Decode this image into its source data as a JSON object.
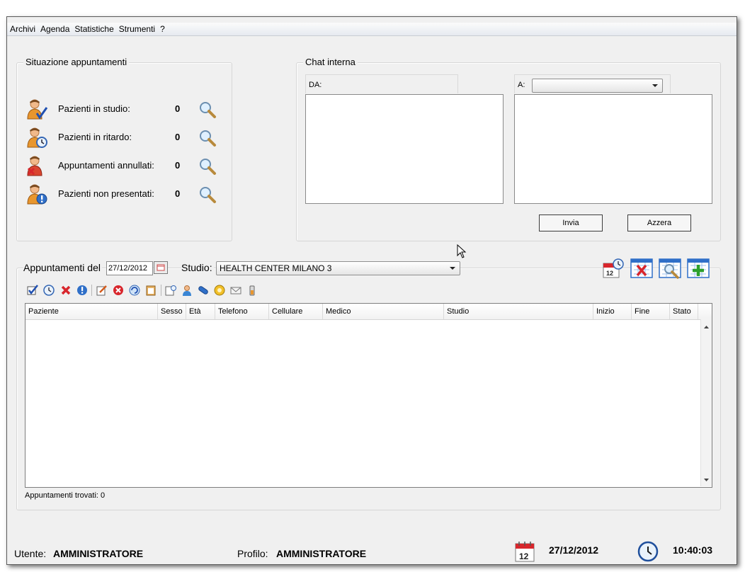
{
  "menu": {
    "items": [
      "Archivi",
      "Agenda",
      "Statistiche",
      "Strumenti",
      "?"
    ]
  },
  "situation": {
    "title": "Situazione appuntamenti",
    "rows": [
      {
        "label": "Pazienti in studio:",
        "value": "0",
        "icon": "patient-check-icon"
      },
      {
        "label": "Pazienti in ritardo:",
        "value": "0",
        "icon": "patient-clock-icon"
      },
      {
        "label": "Appuntamenti annullati:",
        "value": "0",
        "icon": "patient-cancel-icon"
      },
      {
        "label": "Pazienti non presentati:",
        "value": "0",
        "icon": "patient-alert-icon"
      }
    ]
  },
  "chat": {
    "title": "Chat interna",
    "from_label": "DA:",
    "to_label": "A:",
    "to_value": "",
    "send_label": "Invia",
    "reset_label": "Azzera"
  },
  "appointments": {
    "date_label": "Appuntamenti del",
    "date_value": "27/12/2012",
    "studio_label": "Studio:",
    "studio_value": "HEALTH CENTER MILANO 3",
    "columns": [
      "Paziente",
      "Sesso",
      "Età",
      "Telefono",
      "Cellulare",
      "Medico",
      "Studio",
      "Inizio",
      "Fine",
      "Stato"
    ],
    "rows": [],
    "found_text": "Appuntamenti trovati: 0"
  },
  "status": {
    "user_label": "Utente:",
    "user_value": "AMMINISTRATORE",
    "profile_label": "Profilo:",
    "profile_value": "AMMINISTRATORE",
    "date": "27/12/2012",
    "time": "10:40:03",
    "calendar_day": "12"
  },
  "colors": {
    "accent_blue": "#2f6fc8",
    "cancel_red": "#d8262c",
    "window_bg": "#f0f0f0"
  }
}
